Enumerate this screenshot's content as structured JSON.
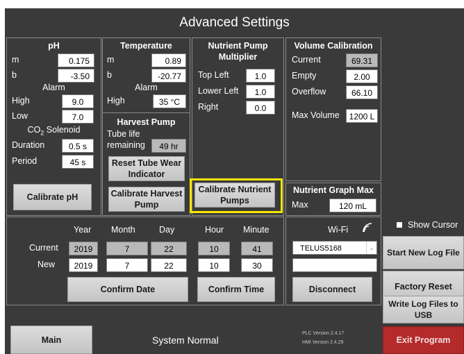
{
  "title": "Advanced Settings",
  "ph": {
    "heading": "pH",
    "m_label": "m",
    "m_value": "0.175",
    "b_label": "b",
    "b_value": "-3.50",
    "alarm_label": "Alarm",
    "high_label": "High",
    "high_value": "9.0",
    "low_label": "Low",
    "low_value": "7.0",
    "co2_label": "CO",
    "co2_sub": "2",
    "co2_rest": " Solenoid",
    "duration_label": "Duration",
    "duration_value": "0.5 s",
    "period_label": "Period",
    "period_value": "45 s",
    "calibrate_label": "Calibrate pH"
  },
  "temperature": {
    "heading": "Temperature",
    "m_label": "m",
    "m_value": "0.89",
    "b_label": "b",
    "b_value": "-20.77",
    "alarm_label": "Alarm",
    "high_label": "High",
    "high_value": "35 °C"
  },
  "harvest": {
    "heading": "Harvest Pump",
    "tube_label_1": "Tube life",
    "tube_label_2": "remaining",
    "tube_value": "49 hr",
    "reset_label_1": "Reset Tube Wear",
    "reset_label_2": "Indicator",
    "calibrate_label_1": "Calibrate Harvest",
    "calibrate_label_2": "Pump"
  },
  "nutrient": {
    "heading_1": "Nutrient Pump",
    "heading_2": "Multiplier",
    "top_left_label": "Top Left",
    "top_left_value": "1.0",
    "lower_left_label": "Lower Left",
    "lower_left_value": "1.0",
    "right_label": "Right",
    "right_value": "0.0",
    "calibrate_label_1": "Calibrate Nutrient",
    "calibrate_label_2": "Pumps"
  },
  "volume": {
    "heading": "Volume Calibration",
    "current_label": "Current",
    "current_value": "69.31",
    "empty_label": "Empty",
    "empty_value": "2.00",
    "overflow_label": "Overflow",
    "overflow_value": "66.10",
    "max_label": "Max Volume",
    "max_value": "1200 L"
  },
  "graph": {
    "heading": "Nutrient Graph Max",
    "max_label": "Max",
    "max_value": "120 mL"
  },
  "datetime": {
    "year_label": "Year",
    "month_label": "Month",
    "day_label": "Day",
    "hour_label": "Hour",
    "minute_label": "Minute",
    "current_label": "Current",
    "new_label": "New",
    "current": {
      "year": "2019",
      "month": "7",
      "day": "22",
      "hour": "10",
      "minute": "41"
    },
    "new": {
      "year": "2019",
      "month": "7",
      "day": "22",
      "hour": "10",
      "minute": "30"
    },
    "confirm_date_label": "Confirm Date",
    "confirm_time_label": "Confirm Time"
  },
  "wifi": {
    "label": "Wi-Fi",
    "network": "TELUS5168",
    "password": "",
    "disconnect_label": "Disconnect"
  },
  "right": {
    "show_cursor_label": "Show Cursor",
    "start_log_label": "Start New Log File",
    "factory_reset_label": "Factory Reset",
    "write_log_label_1": "Write Log Files to",
    "write_log_label_2": "USB",
    "exit_label": "Exit Program"
  },
  "footer": {
    "main_label": "Main",
    "status": "System Normal",
    "plc_version": "PLC Version 2.4.17",
    "hmi_version": "HMI Version 2.4.29"
  },
  "colors": {
    "background": "#3a3a3a",
    "button": "#d0d0d0",
    "exit_button": "#b52a2a",
    "highlight": "#f3e600"
  },
  "icons": {
    "wifi": "wifi-signal-icon",
    "dropdown": "chevron-down-icon",
    "checkbox": "checkbox-icon"
  }
}
